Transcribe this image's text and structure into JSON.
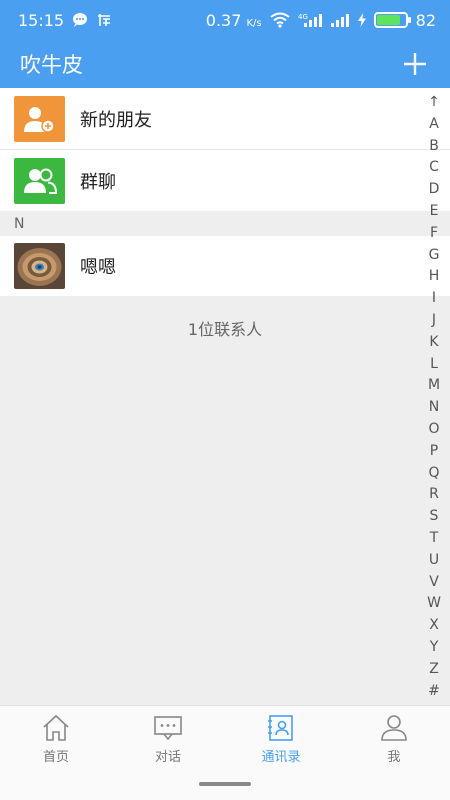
{
  "status_bar": {
    "time": "15:15",
    "speed": "0.37",
    "speed_unit": "K/s",
    "network": "4G",
    "battery": "82",
    "battery_fraction": 0.82,
    "icons": [
      "chat-bubble-icon",
      "taobao-icon",
      "wifi-icon",
      "signal-icon",
      "charging-icon",
      "battery-icon"
    ]
  },
  "app_bar": {
    "title": "吹牛皮",
    "add_icon": "plus-icon"
  },
  "list": {
    "new_friends": "新的朋友",
    "group_chat": "群聊",
    "section_n": "N",
    "contact_name": "嗯嗯",
    "contact_count": "1位联系人"
  },
  "colors": {
    "accent": "#4a9ff0",
    "new_friends_icon_bg": "#f0953a",
    "group_icon_bg": "#3cb73f"
  },
  "alpha_index": [
    "↑",
    "A",
    "B",
    "C",
    "D",
    "E",
    "F",
    "G",
    "H",
    "I",
    "J",
    "K",
    "L",
    "M",
    "N",
    "O",
    "P",
    "Q",
    "R",
    "S",
    "T",
    "U",
    "V",
    "W",
    "X",
    "Y",
    "Z",
    "#"
  ],
  "nav": {
    "home": "首页",
    "chat": "对话",
    "contacts": "通讯录",
    "me": "我",
    "active": "contacts"
  }
}
